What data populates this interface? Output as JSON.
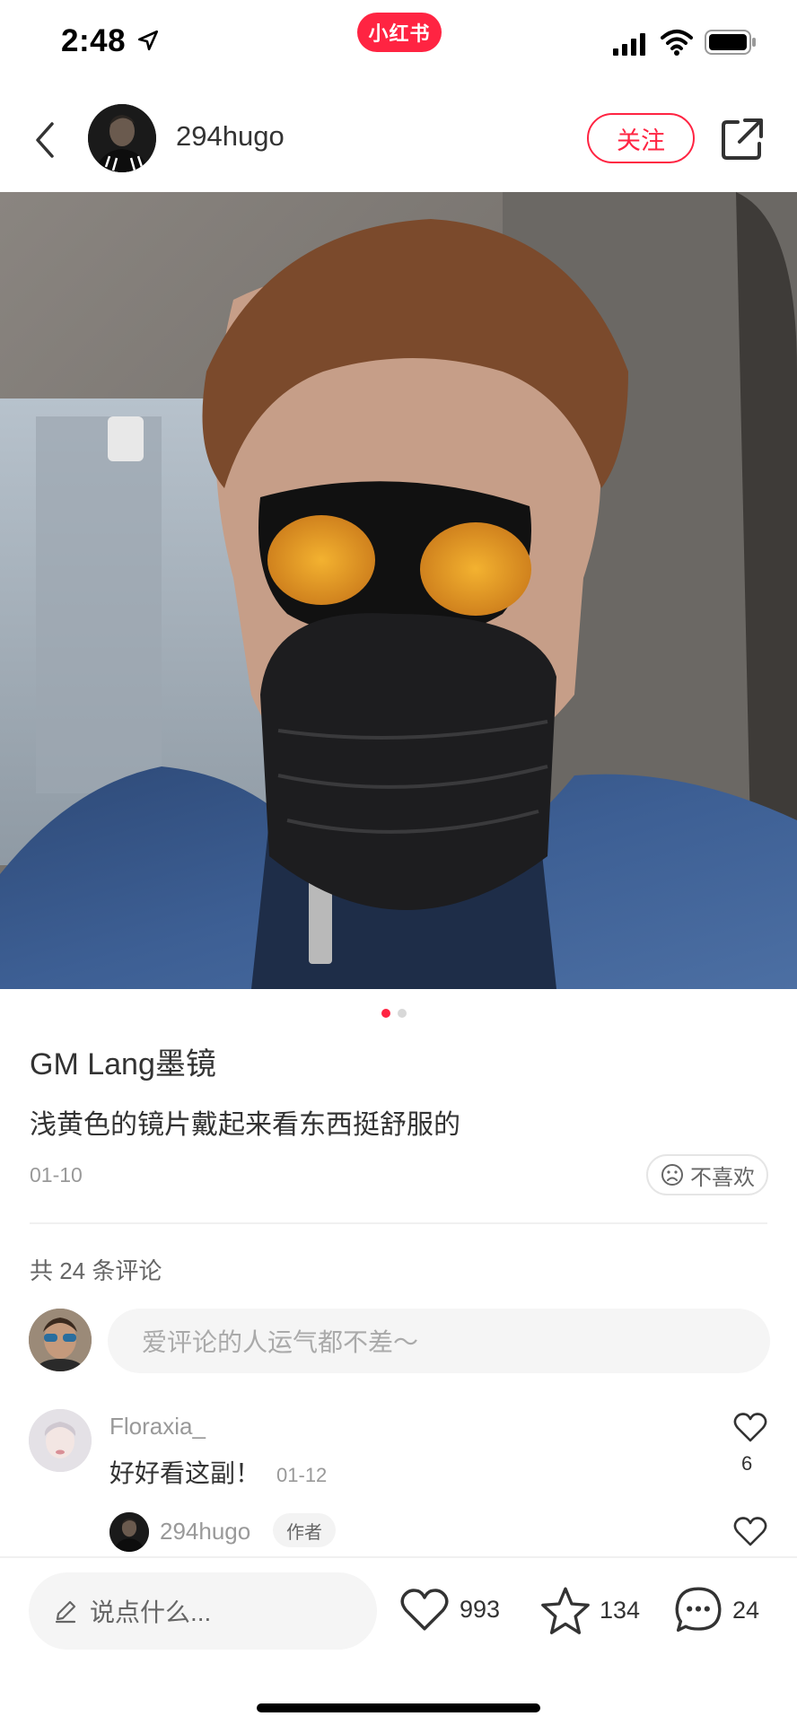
{
  "status_bar": {
    "time": "2:48",
    "brand": "小红书",
    "icons": [
      "location-arrow-icon",
      "cellular-signal-icon",
      "wifi-icon",
      "battery-icon"
    ]
  },
  "header": {
    "author_name": "294hugo",
    "follow_label": "关注",
    "icons": [
      "back-arrow-icon",
      "share-icon"
    ]
  },
  "media": {
    "page_count": 2,
    "current_page": 1
  },
  "note": {
    "title": "GM Lang墨镜",
    "description": "浅黄色的镜片戴起来看东西挺舒服的",
    "date": "01-10",
    "dislike_label": "不喜欢"
  },
  "comments": {
    "count_label": "共 24 条评论",
    "input_placeholder": "爱评论的人运气都不差～",
    "items": [
      {
        "username": "Floraxia_",
        "text": "好好看这副！",
        "date": "01-12",
        "likes": "6",
        "reply": {
          "username": "294hugo",
          "badge": "作者"
        }
      }
    ]
  },
  "bottom_bar": {
    "input_placeholder": "说点什么...",
    "likes": "993",
    "collects": "134",
    "comments": "24"
  },
  "colors": {
    "brand_red": "#ff2442",
    "text_primary": "#333333",
    "text_secondary": "#999999"
  }
}
